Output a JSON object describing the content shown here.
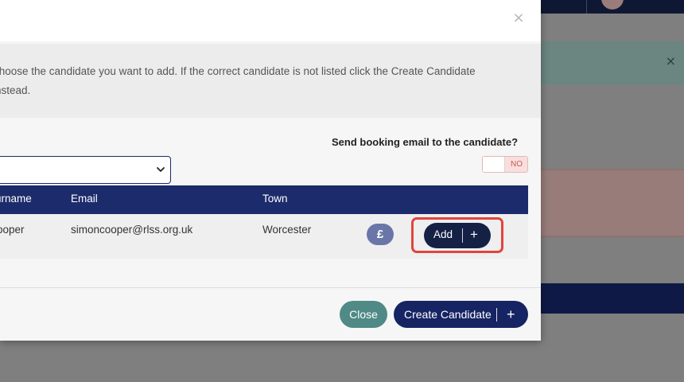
{
  "modal": {
    "close_glyph": "×",
    "info": {
      "line1": "choose the candidate you want to add. If the correct candidate is not listed click the Create Candidate",
      "line2": "nstead."
    },
    "send_email": {
      "label": "Send booking email to the candidate?",
      "toggle_state": "NO"
    },
    "select": {
      "value": ""
    },
    "table": {
      "columns": [
        "urname",
        "Email",
        "Town"
      ],
      "rows": [
        {
          "surname": "ooper",
          "email": "simoncooper@rlss.org.uk",
          "town": "Worcester",
          "badge": "£",
          "add_label": "Add",
          "add_icon": "+"
        }
      ]
    },
    "footer": {
      "close_label": "Close",
      "create_label": "Create Candidate",
      "create_icon": "+"
    }
  },
  "background": {
    "alert_close_glyph": "×"
  },
  "colors": {
    "primary_navy": "#1c2b6b",
    "teal": "#4f8a86",
    "highlight_red": "#e0453d",
    "badge_purple": "#6a76a8"
  },
  "icons": {
    "modal_close": "close-icon",
    "select_chevron": "chevron-down-icon",
    "badge": "pound-icon",
    "add": "plus-icon"
  }
}
